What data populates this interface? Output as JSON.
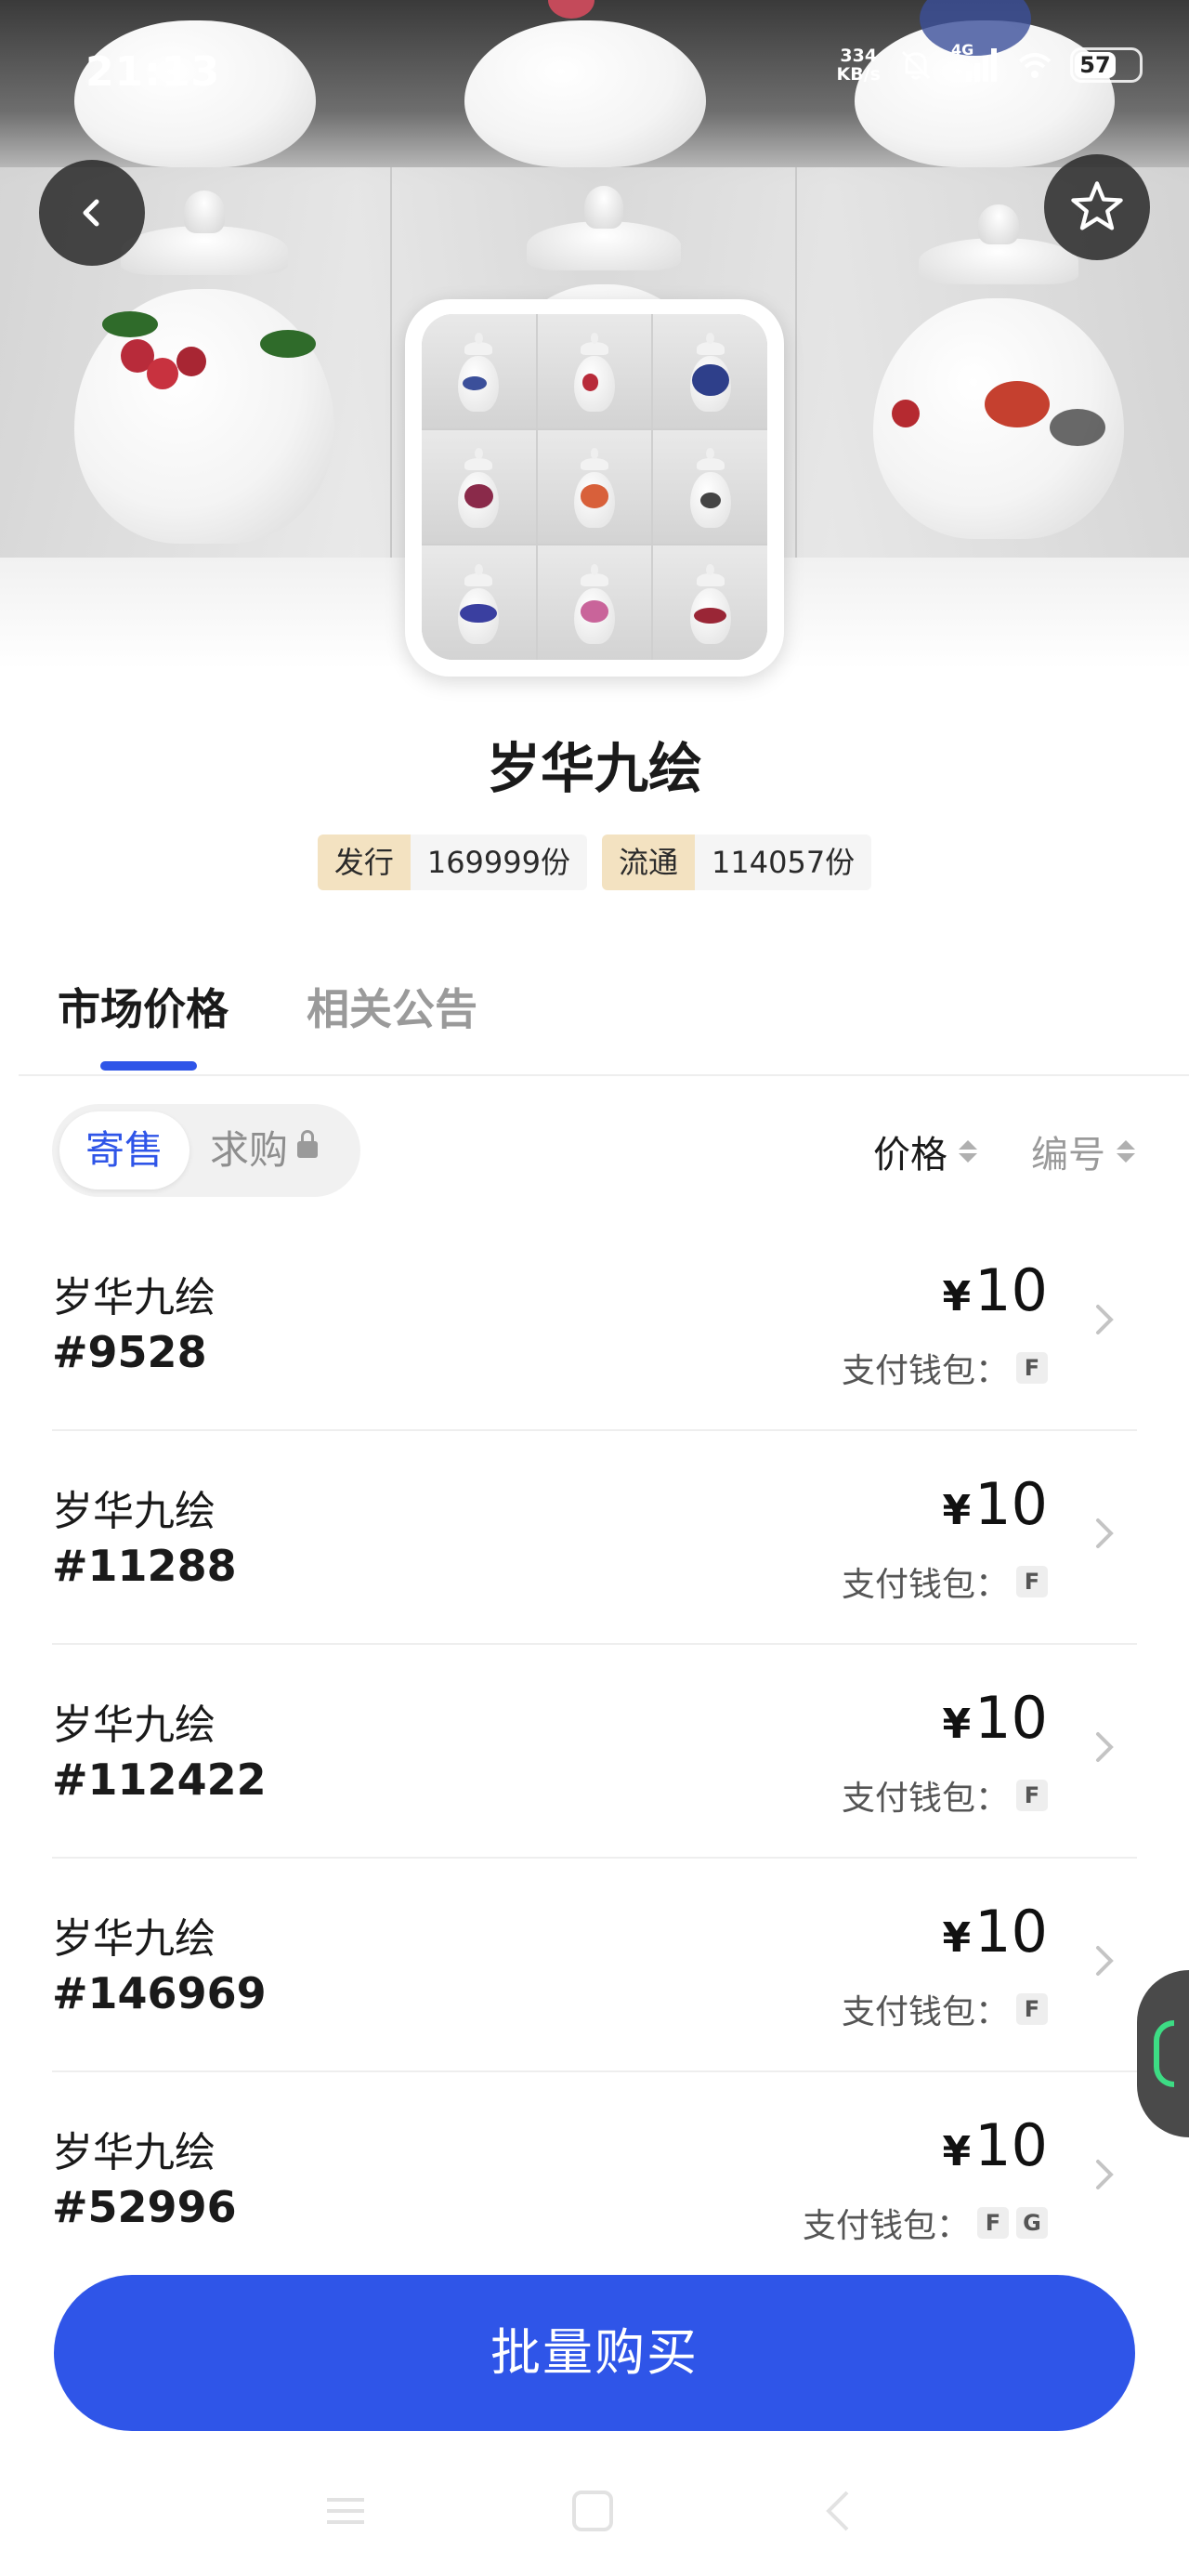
{
  "status_bar": {
    "time": "21:13",
    "net_speed_value": "334",
    "net_speed_unit": "KB/s",
    "signal_label": "4G",
    "battery": "57"
  },
  "product": {
    "title": "岁华九绘",
    "stats": [
      {
        "label": "发行",
        "value": "169999份"
      },
      {
        "label": "流通",
        "value": "114057份"
      }
    ]
  },
  "tabs": [
    {
      "label": "市场价格",
      "active": true
    },
    {
      "label": "相关公告",
      "active": false
    }
  ],
  "filter": {
    "segment_active": "寄售",
    "segment_locked": "求购",
    "sort_price": "价格",
    "sort_number": "编号"
  },
  "listings": [
    {
      "name": "岁华九绘",
      "serial": "#9528",
      "currency": "¥",
      "price": "10",
      "wallet_label": "支付钱包：",
      "wallets": [
        "F"
      ]
    },
    {
      "name": "岁华九绘",
      "serial": "#11288",
      "currency": "¥",
      "price": "10",
      "wallet_label": "支付钱包：",
      "wallets": [
        "F"
      ]
    },
    {
      "name": "岁华九绘",
      "serial": "#112422",
      "currency": "¥",
      "price": "10",
      "wallet_label": "支付钱包：",
      "wallets": [
        "F"
      ]
    },
    {
      "name": "岁华九绘",
      "serial": "#146969",
      "currency": "¥",
      "price": "10",
      "wallet_label": "支付钱包：",
      "wallets": [
        "F"
      ]
    },
    {
      "name": "岁华九绘",
      "serial": "#52996",
      "currency": "¥",
      "price": "10",
      "wallet_label": "支付钱包：",
      "wallets": [
        "F",
        "G"
      ]
    }
  ],
  "actions": {
    "bulk_buy": "批量购买"
  },
  "colors": {
    "accent": "#2f55e8",
    "stat_key_bg": "#f3e2c1",
    "status_green": "#3ddc84"
  },
  "icons": [
    "back-arrow-icon",
    "star-icon",
    "mute-bell-icon",
    "signal-icon",
    "wifi-icon",
    "battery-icon",
    "lock-icon",
    "sort-icon",
    "chevron-right-icon"
  ]
}
